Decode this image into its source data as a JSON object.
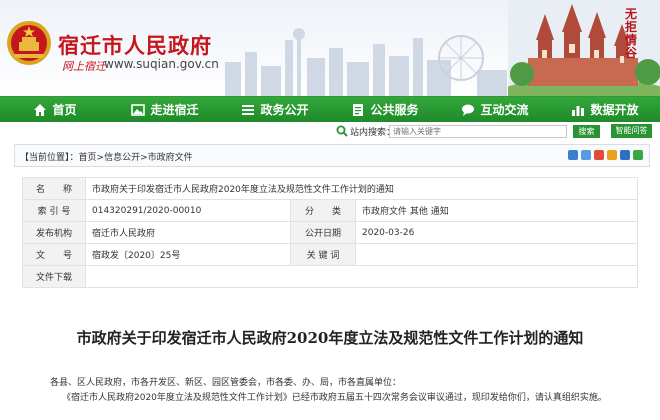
{
  "header": {
    "site_title": "宿迁市人民政府",
    "slogan": "网上宿迁",
    "url": "www.suqian.gov.cn",
    "calligraphy": "无拒情谷"
  },
  "nav": {
    "items": [
      {
        "label": "首页",
        "icon": "home-icon"
      },
      {
        "label": "走进宿迁",
        "icon": "picture-icon"
      },
      {
        "label": "政务公开",
        "icon": "list-icon"
      },
      {
        "label": "公共服务",
        "icon": "document-icon"
      },
      {
        "label": "互动交流",
        "icon": "chat-icon"
      },
      {
        "label": "数据开放",
        "icon": "bar-chart-icon"
      }
    ]
  },
  "search": {
    "label": "站内搜索：",
    "placeholder": "请输入关键字",
    "button": "搜索",
    "smart_qa": "智能问答"
  },
  "breadcrumb": {
    "current_label": "【当前位置】：",
    "items": [
      "首页",
      "信息公开",
      "市政府文件"
    ],
    "separator": ">"
  },
  "info": {
    "name_label": "名　　称",
    "name_value": "市政府关于印发宿迁市人民政府2020年度立法及规范性文件工作计划的通知",
    "index_label": "索 引 号",
    "index_value": "014320291/2020-00010",
    "category_label": "分　　类",
    "category_value": "市政府文件  其他  通知",
    "issuer_label": "发布机构",
    "issuer_value": "宿迁市人民政府",
    "date_label": "公开日期",
    "date_value": "2020-03-26",
    "docno_label": "文　　号",
    "docno_value": "宿政发〔2020〕25号",
    "keywords_label": "关 键 词",
    "keywords_value": "",
    "download_label": "文件下载",
    "download_value": ""
  },
  "document": {
    "title": "市政府关于印发宿迁市人民政府2020年度立法及规范性文件工作计划的通知",
    "addressee": "各县、区人民政府，市各开发区、新区、园区管委会，市各委、办、局，市各直属单位：",
    "body": "《宿迁市人民政府2020年度立法及规范性文件工作计划》已经市政府五届五十四次常务会议审议通过，现印发给你们，请认真组织实施。"
  },
  "colors": {
    "brand_red": "#c4161c",
    "nav_green": "#2a9434"
  }
}
